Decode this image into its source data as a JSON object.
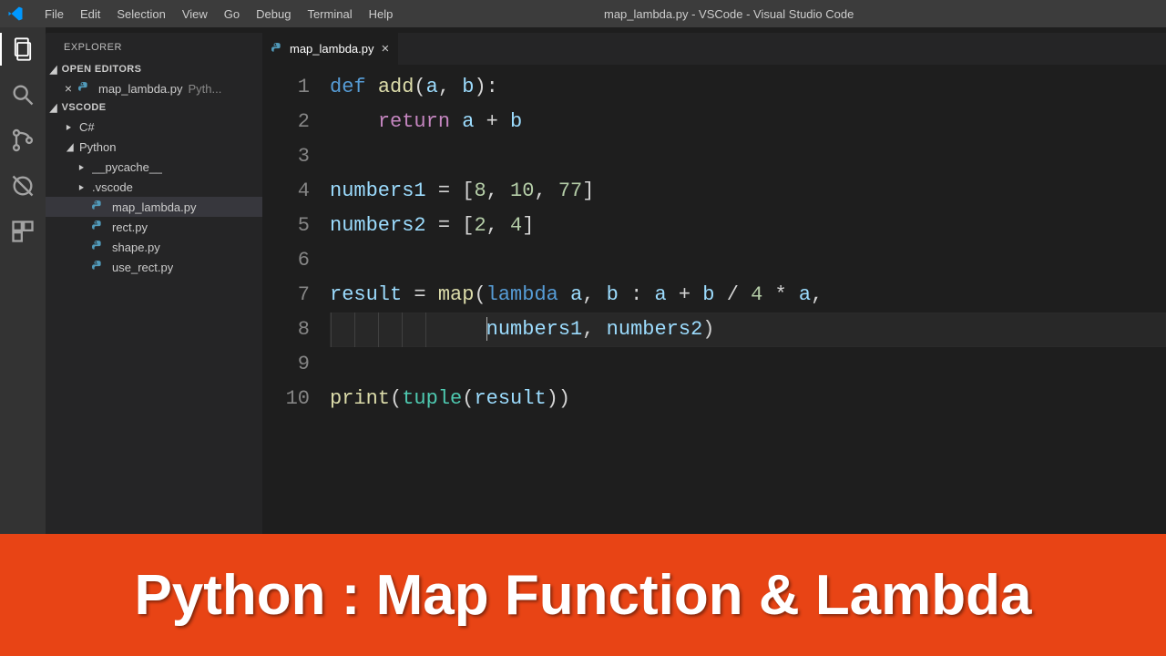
{
  "window": {
    "title": "map_lambda.py  -  VSCode  -  Visual Studio Code"
  },
  "menu": [
    "File",
    "Edit",
    "Selection",
    "View",
    "Go",
    "Debug",
    "Terminal",
    "Help"
  ],
  "activity": {
    "items": [
      "files-icon",
      "search-icon",
      "source-control-icon",
      "debug-icon",
      "extensions-icon"
    ],
    "active": 0
  },
  "sidebar": {
    "title": "EXPLORER",
    "sections": {
      "open_editors": {
        "label": "OPEN EDITORS",
        "items": [
          {
            "name": "map_lambda.py",
            "desc": "Pyth..."
          }
        ]
      },
      "workspace": {
        "label": "VSCODE",
        "tree": [
          {
            "type": "folder",
            "expanded": false,
            "name": "C#",
            "indent": 1
          },
          {
            "type": "folder",
            "expanded": true,
            "name": "Python",
            "indent": 1
          },
          {
            "type": "folder",
            "expanded": false,
            "name": "__pycache__",
            "indent": 2
          },
          {
            "type": "folder",
            "expanded": false,
            "name": ".vscode",
            "indent": 2
          },
          {
            "type": "file",
            "name": "map_lambda.py",
            "indent": 2,
            "selected": true
          },
          {
            "type": "file",
            "name": "rect.py",
            "indent": 2
          },
          {
            "type": "file",
            "name": "shape.py",
            "indent": 2
          },
          {
            "type": "file",
            "name": "use_rect.py",
            "indent": 2
          }
        ]
      }
    }
  },
  "editor": {
    "tab": {
      "name": "map_lambda.py"
    },
    "active_line": 8,
    "lines": [
      [
        {
          "t": "def ",
          "c": "kw"
        },
        {
          "t": "add",
          "c": "fn"
        },
        {
          "t": "(",
          "c": "op"
        },
        {
          "t": "a",
          "c": "var"
        },
        {
          "t": ", ",
          "c": "op"
        },
        {
          "t": "b",
          "c": "var"
        },
        {
          "t": "):",
          "c": "op"
        }
      ],
      [
        {
          "t": "    ",
          "c": "op"
        },
        {
          "t": "return ",
          "c": "kw2"
        },
        {
          "t": "a",
          "c": "var"
        },
        {
          "t": " + ",
          "c": "op"
        },
        {
          "t": "b",
          "c": "var"
        }
      ],
      [],
      [
        {
          "t": "numbers1",
          "c": "var"
        },
        {
          "t": " = [",
          "c": "op"
        },
        {
          "t": "8",
          "c": "num"
        },
        {
          "t": ", ",
          "c": "op"
        },
        {
          "t": "10",
          "c": "num"
        },
        {
          "t": ", ",
          "c": "op"
        },
        {
          "t": "77",
          "c": "num"
        },
        {
          "t": "]",
          "c": "op"
        }
      ],
      [
        {
          "t": "numbers2",
          "c": "var"
        },
        {
          "t": " = [",
          "c": "op"
        },
        {
          "t": "2",
          "c": "num"
        },
        {
          "t": ", ",
          "c": "op"
        },
        {
          "t": "4",
          "c": "num"
        },
        {
          "t": "]",
          "c": "op"
        }
      ],
      [],
      [
        {
          "t": "result",
          "c": "var"
        },
        {
          "t": " = ",
          "c": "op"
        },
        {
          "t": "map",
          "c": "fn"
        },
        {
          "t": "(",
          "c": "op"
        },
        {
          "t": "lambda ",
          "c": "kw"
        },
        {
          "t": "a",
          "c": "var"
        },
        {
          "t": ", ",
          "c": "op"
        },
        {
          "t": "b",
          "c": "var"
        },
        {
          "t": " : ",
          "c": "op"
        },
        {
          "t": "a",
          "c": "var"
        },
        {
          "t": " + ",
          "c": "op"
        },
        {
          "t": "b",
          "c": "var"
        },
        {
          "t": " / ",
          "c": "op"
        },
        {
          "t": "4",
          "c": "num"
        },
        {
          "t": " * ",
          "c": "op"
        },
        {
          "t": "a",
          "c": "var"
        },
        {
          "t": ",",
          "c": "op"
        }
      ],
      [
        {
          "t": "             ",
          "c": "op"
        },
        {
          "t": "numbers1",
          "c": "var"
        },
        {
          "t": ", ",
          "c": "op"
        },
        {
          "t": "numbers2",
          "c": "var"
        },
        {
          "t": ")",
          "c": "op"
        }
      ],
      [],
      [
        {
          "t": "print",
          "c": "fn"
        },
        {
          "t": "(",
          "c": "op"
        },
        {
          "t": "tuple",
          "c": "cls"
        },
        {
          "t": "(",
          "c": "op"
        },
        {
          "t": "result",
          "c": "var"
        },
        {
          "t": "))",
          "c": "op"
        }
      ]
    ]
  },
  "banner": {
    "text": "Python : Map Function & Lambda"
  },
  "colors": {
    "accent": "#007acc",
    "banner": "#e84415"
  }
}
